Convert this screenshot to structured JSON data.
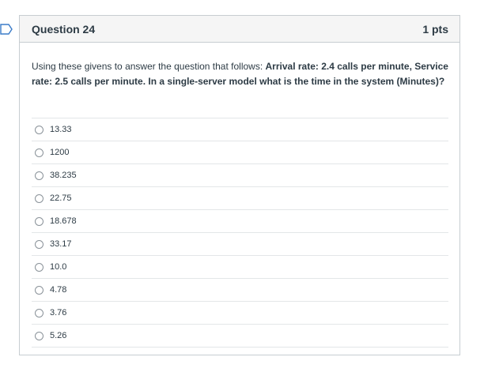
{
  "question": {
    "title": "Question 24",
    "points": "1 pts",
    "text_plain": "Using these givens to answer the question that follows: ",
    "text_bold": "Arrival rate: 2.4 calls per minute, Service rate: 2.5 calls per minute.  In a single-server model what is the time in the system (Minutes)?"
  },
  "answers": [
    "13.33",
    "1200",
    "38.235",
    "22.75",
    "18.678",
    "33.17",
    "10.0",
    "4.78",
    "3.76",
    "5.26"
  ],
  "colors": {
    "flag": "#3a7bc8",
    "border": "#c7cdd1",
    "header_bg": "#f5f5f5",
    "text": "#2d3b45"
  }
}
